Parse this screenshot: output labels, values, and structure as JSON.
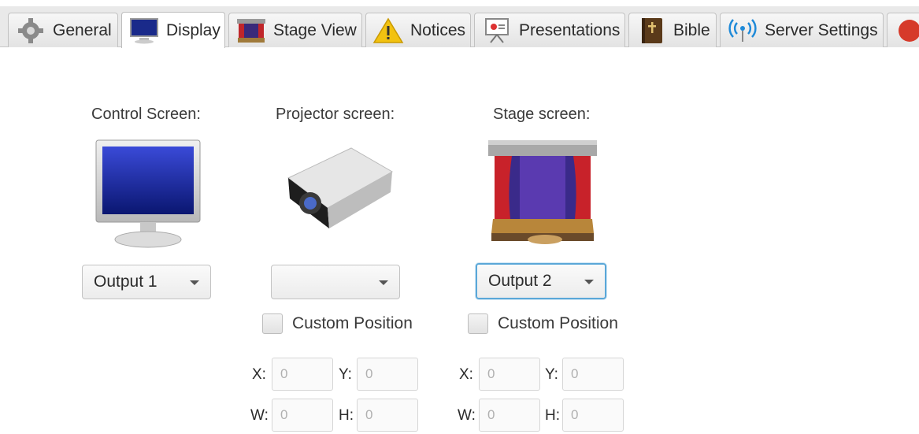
{
  "tabs": [
    {
      "label": "General",
      "icon": "gear-icon"
    },
    {
      "label": "Display",
      "icon": "monitor-icon",
      "active": true
    },
    {
      "label": "Stage View",
      "icon": "stage-icon"
    },
    {
      "label": "Notices",
      "icon": "warning-icon"
    },
    {
      "label": "Presentations",
      "icon": "presentation-icon"
    },
    {
      "label": "Bible",
      "icon": "bible-icon"
    },
    {
      "label": "Server Settings",
      "icon": "broadcast-icon"
    }
  ],
  "control": {
    "title": "Control Screen:",
    "selected": "Output 1"
  },
  "projector": {
    "title": "Projector screen:",
    "selected": "",
    "custom_position_label": "Custom Position",
    "x_label": "X:",
    "x_value": "0",
    "y_label": "Y:",
    "y_value": "0",
    "w_label": "W:",
    "w_value": "0",
    "h_label": "H:",
    "h_value": "0"
  },
  "stage": {
    "title": "Stage screen:",
    "selected": "Output 2",
    "custom_position_label": "Custom Position",
    "x_label": "X:",
    "x_value": "0",
    "y_label": "Y:",
    "y_value": "0",
    "w_label": "W:",
    "w_value": "0",
    "h_label": "H:",
    "h_value": "0"
  },
  "colors": {
    "focus_border": "#5aa7d8",
    "tab_bar": "#e9e9e9"
  }
}
